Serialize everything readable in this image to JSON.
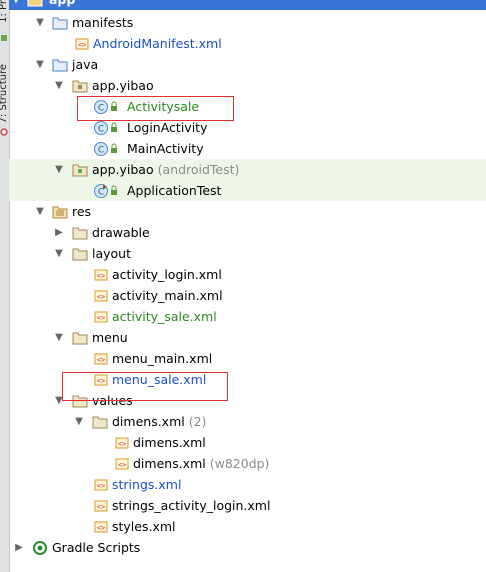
{
  "side_strip": {
    "label_top": "1: Pr",
    "label_structure": "7: Structure"
  },
  "tree": {
    "root": "app",
    "manifests": "manifests",
    "android_manifest": "AndroidManifest.xml",
    "java": "java",
    "pkg_main": "app.yibao",
    "activity_sale": "Activitysale",
    "login_activity": "LoginActivity",
    "main_activity": "MainActivity",
    "pkg_test": "app.yibao",
    "pkg_test_suffix": "(androidTest)",
    "application_test": "ApplicationTest",
    "res": "res",
    "drawable": "drawable",
    "layout": "layout",
    "activity_login": "activity_login.xml",
    "activity_main": "activity_main.xml",
    "activity_sale_xml": "activity_sale.xml",
    "menu": "menu",
    "menu_main": "menu_main.xml",
    "menu_sale": "menu_sale.xml",
    "values": "values",
    "dimens": "dimens.xml",
    "dimens_count": "(2)",
    "dimens_1": "dimens.xml",
    "dimens_2": "dimens.xml",
    "dimens_2_suffix": "(w820dp)",
    "strings": "strings.xml",
    "strings_activity_login": "strings_activity_login.xml",
    "styles": "styles.xml",
    "gradle_scripts": "Gradle Scripts"
  },
  "colors": {
    "selection": "#3875d7",
    "new_file_green": "#268a1a",
    "modified_blue": "#1a4fc8",
    "annotation_red": "#e03030"
  }
}
